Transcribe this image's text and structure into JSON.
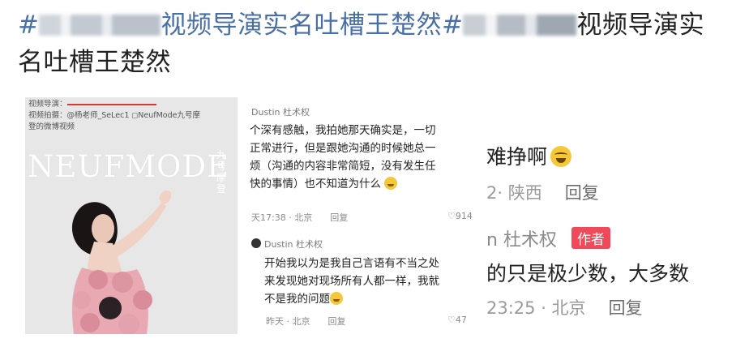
{
  "header": {
    "hash1": "#",
    "title1": "视频导演实名吐槽王楚然",
    "hash2": "#",
    "title2": "视频导演实名吐槽王楚然"
  },
  "left_panel": {
    "credit_line1": "视频导演：",
    "credit_line2": "视频拍摄：@杨老师_SeLec1 ◻NeufMode九号摩",
    "credit_line3": "登的微博视频",
    "magazine_title": "NEUFMODE",
    "magazine_side": "九号摩登"
  },
  "middle_panel": {
    "c1_user": "Dustin 杜术权",
    "c1_lines": [
      "个深有感触，我拍她那天确实是，一切",
      "正常进行，但是跟她沟通的时候她总一",
      "烦（沟通的内容非常简短，没有发生任",
      "快的事情）也不知道为什么"
    ],
    "c1_time": "天17:38 · 北京",
    "c1_reply": "回复",
    "c1_likes": "♡914",
    "c2_user": "Dustin 杜术权",
    "c2_lines": [
      "开始我以为是我自己言语有不当之处",
      "来发现她对现场所有人都一样，我就",
      "不是我的问题"
    ],
    "c2_time": "昨天 · 北京",
    "c2_reply": "回复",
    "c2_likes": "♡47"
  },
  "right_panel": {
    "line1": "难挣啊",
    "meta1_loc": "2· 陕西",
    "meta1_reply": "回复",
    "user": "n 杜术权",
    "author_badge": "作者",
    "line2": "的只是极少数，大多数",
    "meta2_time": "23:25 · 北京",
    "meta2_reply": "回复"
  },
  "colors": {
    "hashtag": "#4a6fa5",
    "author_badge": "#f04a5a",
    "emoji": "#f5c83b"
  }
}
